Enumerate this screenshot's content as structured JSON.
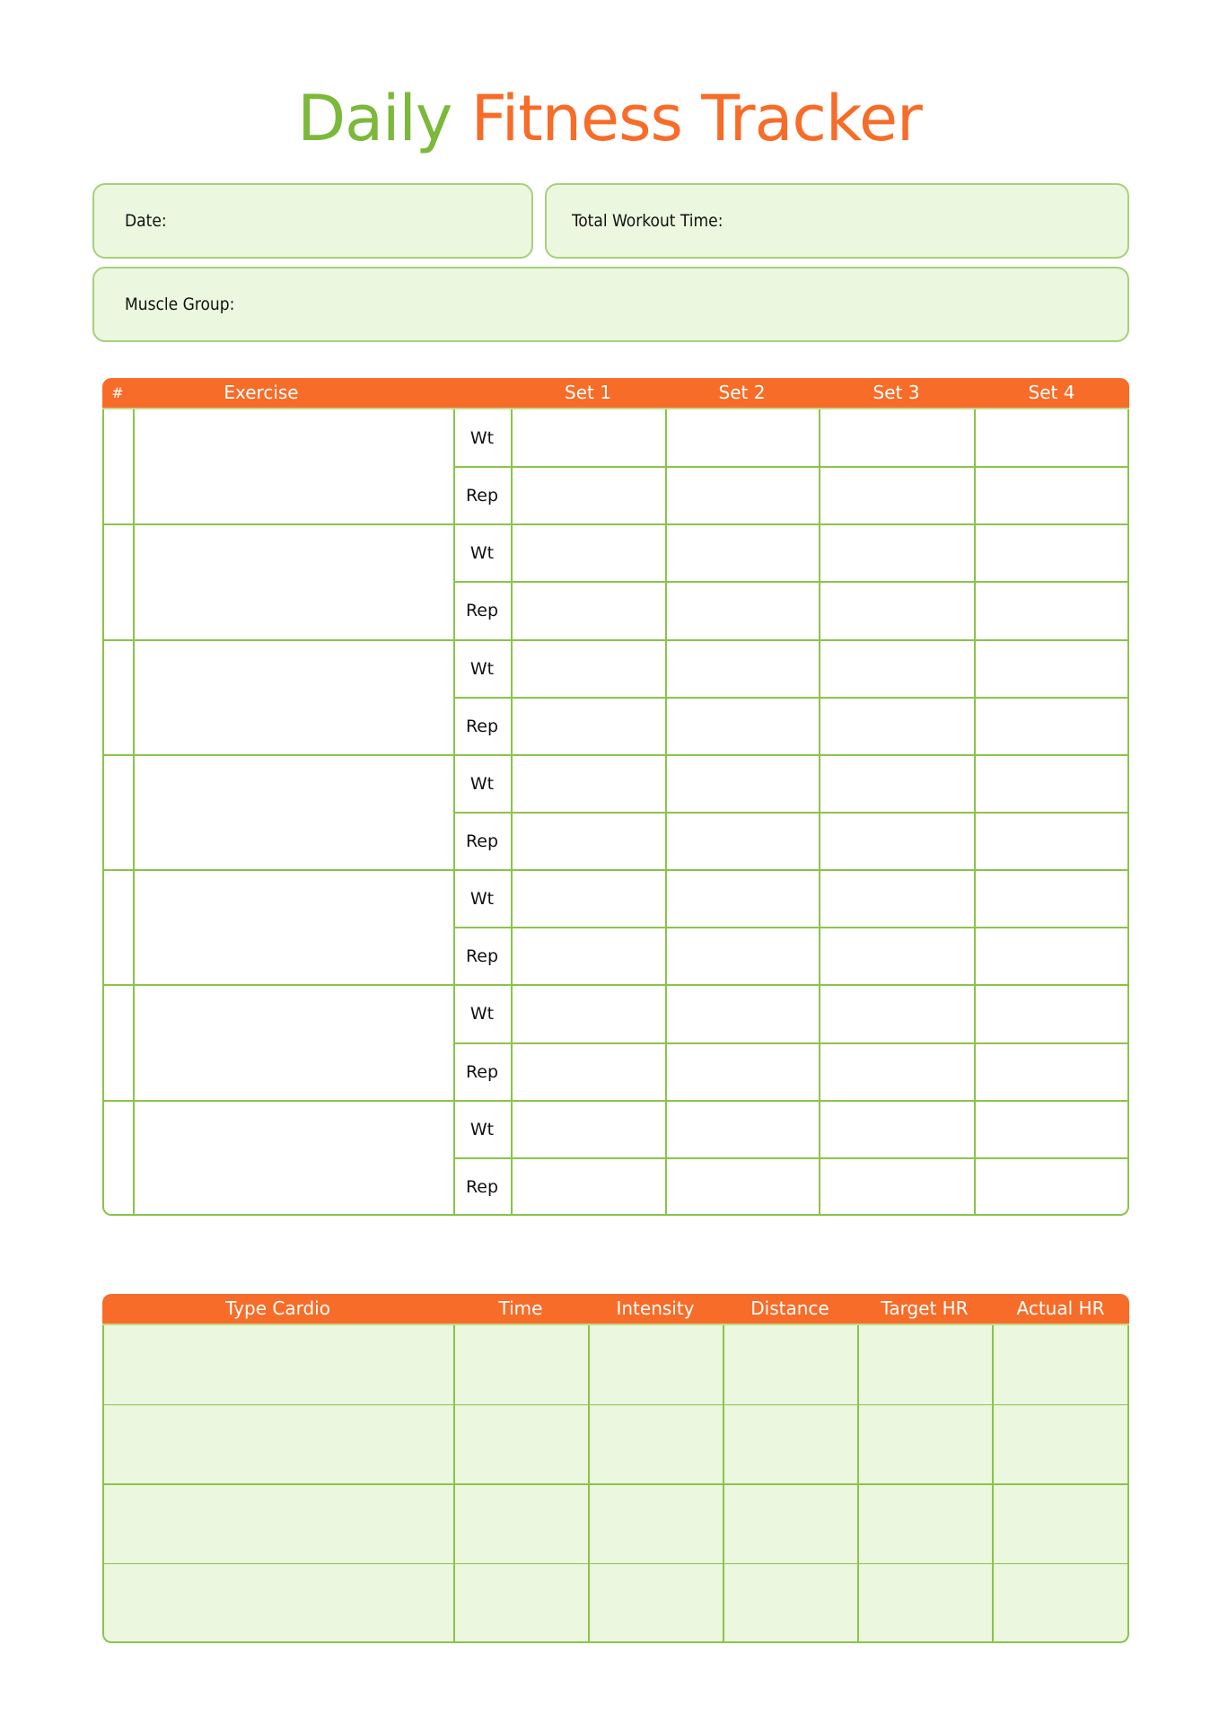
{
  "title": {
    "part1": "Daily",
    "part2": "Fitness Tracker"
  },
  "colors": {
    "green": "#7cb83a",
    "orange": "#f76c28",
    "card_bg": "#ebf7de",
    "border": "#8bc34a"
  },
  "fields": {
    "date_label": "Date:",
    "total_time_label": "Total Workout Time:",
    "muscle_group_label": "Muscle Group:"
  },
  "strength_table": {
    "headers": {
      "number": "#",
      "exercise": "Exercise",
      "set1": "Set 1",
      "set2": "Set 2",
      "set3": "Set 3",
      "set4": "Set 4"
    },
    "row_labels": {
      "weight": "Wt",
      "reps": "Rep"
    },
    "rows": [
      {
        "number": "",
        "exercise": "",
        "wt": [
          "",
          "",
          "",
          ""
        ],
        "rep": [
          "",
          "",
          "",
          ""
        ]
      },
      {
        "number": "",
        "exercise": "",
        "wt": [
          "",
          "",
          "",
          ""
        ],
        "rep": [
          "",
          "",
          "",
          ""
        ]
      },
      {
        "number": "",
        "exercise": "",
        "wt": [
          "",
          "",
          "",
          ""
        ],
        "rep": [
          "",
          "",
          "",
          ""
        ]
      },
      {
        "number": "",
        "exercise": "",
        "wt": [
          "",
          "",
          "",
          ""
        ],
        "rep": [
          "",
          "",
          "",
          ""
        ]
      },
      {
        "number": "",
        "exercise": "",
        "wt": [
          "",
          "",
          "",
          ""
        ],
        "rep": [
          "",
          "",
          "",
          ""
        ]
      },
      {
        "number": "",
        "exercise": "",
        "wt": [
          "",
          "",
          "",
          ""
        ],
        "rep": [
          "",
          "",
          "",
          ""
        ]
      },
      {
        "number": "",
        "exercise": "",
        "wt": [
          "",
          "",
          "",
          ""
        ],
        "rep": [
          "",
          "",
          "",
          ""
        ]
      }
    ]
  },
  "cardio_table": {
    "headers": [
      "Type Cardio",
      "Time",
      "Intensity",
      "Distance",
      "Target HR",
      "Actual HR"
    ],
    "rows": [
      [
        "",
        "",
        "",
        "",
        "",
        ""
      ],
      [
        "",
        "",
        "",
        "",
        "",
        ""
      ],
      [
        "",
        "",
        "",
        "",
        "",
        ""
      ],
      [
        "",
        "",
        "",
        "",
        "",
        ""
      ]
    ]
  }
}
